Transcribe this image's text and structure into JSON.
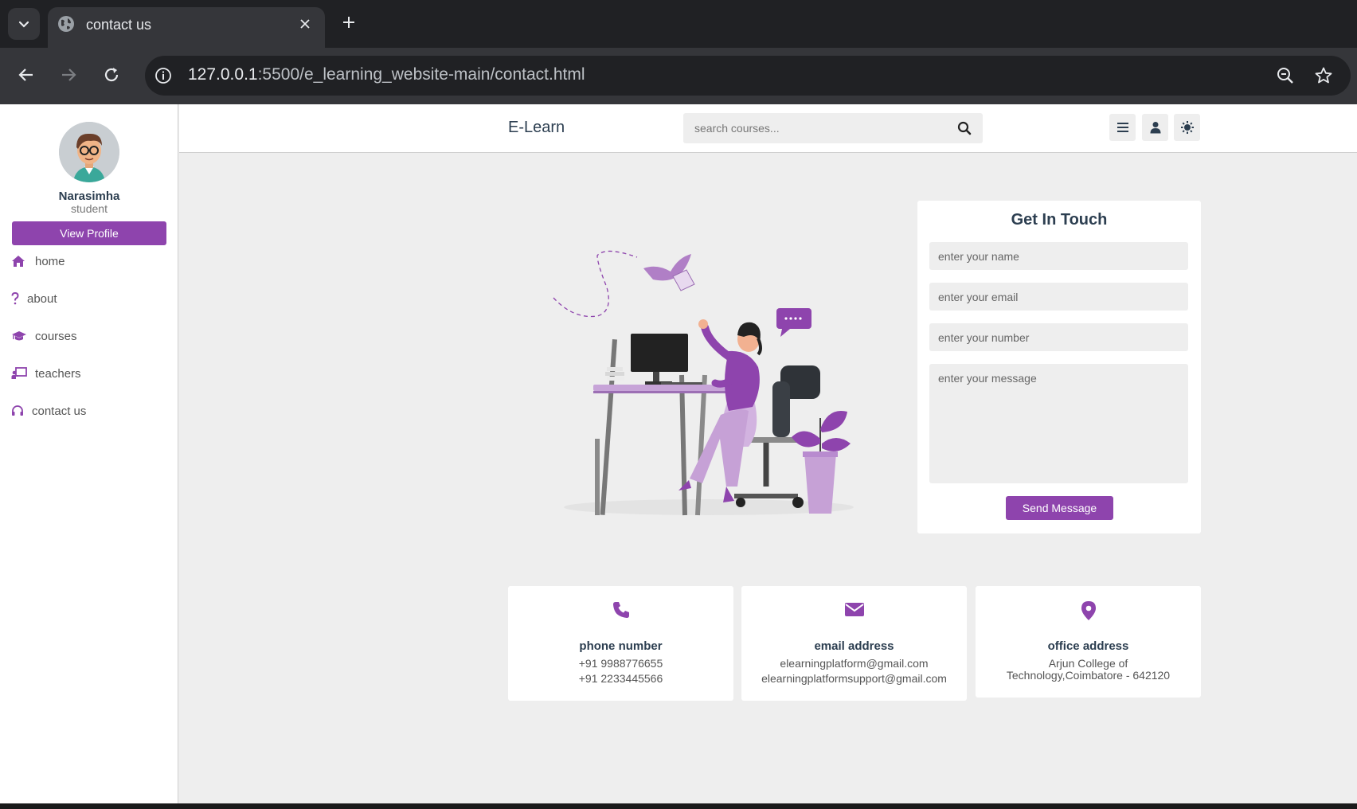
{
  "browser": {
    "tab_title": "contact us",
    "url_host": "127.0.0.1",
    "url_path": ":5500/e_learning_website-main/contact.html"
  },
  "sidebar": {
    "user_name": "Narasimha",
    "user_role": "student",
    "view_profile_label": "View Profile",
    "items": [
      {
        "label": "home",
        "icon": "home-icon"
      },
      {
        "label": "about",
        "icon": "question-icon"
      },
      {
        "label": "courses",
        "icon": "graduation-cap-icon"
      },
      {
        "label": "teachers",
        "icon": "chalkboard-teacher-icon"
      },
      {
        "label": "contact us",
        "icon": "headset-icon"
      }
    ]
  },
  "header": {
    "logo": "E-Learn",
    "search_placeholder": "search courses..."
  },
  "form": {
    "title": "Get In Touch",
    "name_placeholder": "enter your name",
    "email_placeholder": "enter your email",
    "number_placeholder": "enter your number",
    "message_placeholder": "enter your message",
    "send_label": "Send Message"
  },
  "info": {
    "phone": {
      "title": "phone number",
      "line1": "+91 9988776655",
      "line2": "+91 2233445566"
    },
    "email": {
      "title": "email address",
      "line1": "elearningplatform@gmail.com",
      "line2": "elearningplatformsupport@gmail.com"
    },
    "office": {
      "title": "office address",
      "line1": "Arjun College of",
      "line2": "Technology,Coimbatore - 642120"
    }
  },
  "colors": {
    "accent": "#8e44ad",
    "heading": "#2c3e50",
    "page_bg": "#eeeeee"
  }
}
